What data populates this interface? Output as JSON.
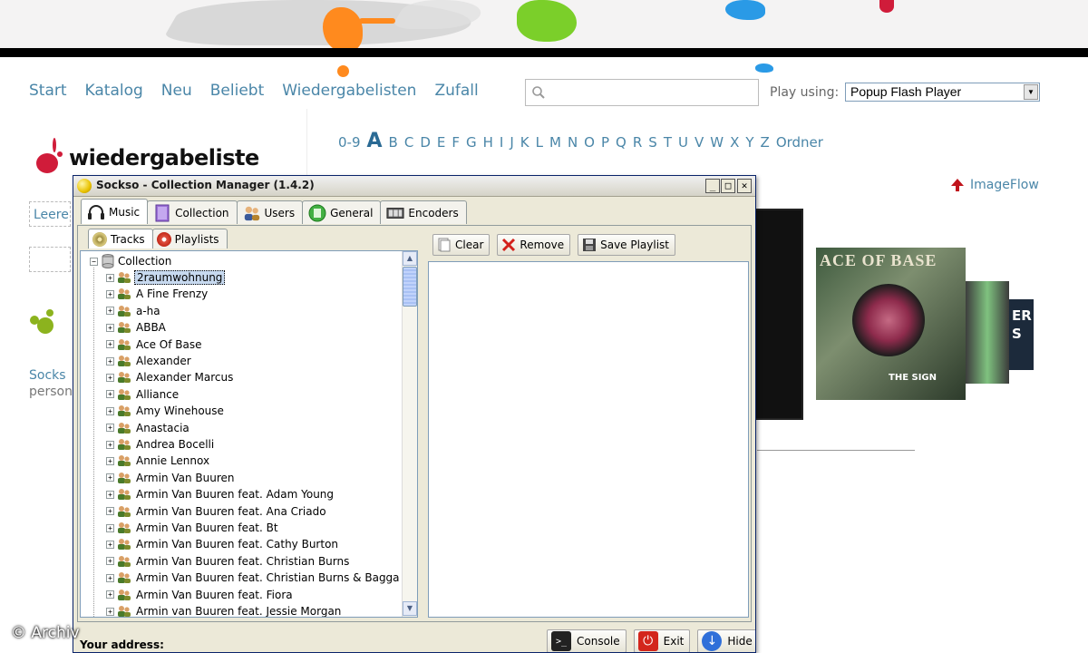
{
  "nav": {
    "items": [
      "Start",
      "Katalog",
      "Neu",
      "Beliebt",
      "Wiedergabelisten",
      "Zufall"
    ]
  },
  "search": {
    "value": "",
    "placeholder": ""
  },
  "player": {
    "label": "Play using:",
    "selected": "Popup Flash Player"
  },
  "alphabet": [
    "0-9",
    "A",
    "B",
    "C",
    "D",
    "E",
    "F",
    "G",
    "H",
    "I",
    "J",
    "K",
    "L",
    "M",
    "N",
    "O",
    "P",
    "Q",
    "R",
    "S",
    "T",
    "U",
    "V",
    "W",
    "X",
    "Y",
    "Z",
    "Ordner"
  ],
  "page": {
    "heading": "wiedergabeliste",
    "leere": "Leere",
    "sockso": "Socks",
    "person": "person"
  },
  "imageflow": {
    "label": "ImageFlow"
  },
  "covers": {
    "ace_title": "ACE OF BASE",
    "ace_sub": "THE SIGN",
    "small": "ER\nS"
  },
  "dialog": {
    "title": "Sockso - Collection Manager (1.4.2)",
    "window_buttons": [
      "_",
      "□",
      "✕"
    ],
    "tabs": [
      {
        "label": "Music",
        "icon": "headphones-icon",
        "active": true
      },
      {
        "label": "Collection",
        "icon": "collection-icon",
        "active": false
      },
      {
        "label": "Users",
        "icon": "users-icon",
        "active": false
      },
      {
        "label": "General",
        "icon": "general-icon",
        "active": false
      },
      {
        "label": "Encoders",
        "icon": "encoders-icon",
        "active": false
      }
    ],
    "subtabs": [
      {
        "label": "Tracks",
        "icon": "tracks-icon",
        "active": true
      },
      {
        "label": "Playlists",
        "icon": "playlists-icon",
        "active": false
      }
    ],
    "tree": {
      "root": "Collection",
      "selected": "2raumwohnung",
      "artists": [
        "2raumwohnung",
        "A Fine Frenzy",
        "a-ha",
        "ABBA",
        "Ace Of Base",
        "Alexander",
        "Alexander Marcus",
        "Alliance",
        "Amy Winehouse",
        "Anastacia",
        "Andrea Bocelli",
        "Annie Lennox",
        "Armin Van Buuren",
        "Armin Van Buuren feat. Adam Young",
        "Armin Van Buuren feat. Ana Criado",
        "Armin Van Buuren feat. Bt",
        "Armin Van Buuren feat. Cathy Burton",
        "Armin Van Buuren feat. Christian Burns",
        "Armin Van Buuren feat. Christian Burns & Bagga Bownz",
        "Armin Van Buuren feat. Fiora",
        "Armin van Buuren feat. Jessie Morgan"
      ]
    },
    "toolbar": {
      "clear": "Clear",
      "remove": "Remove",
      "save_playlist": "Save Playlist"
    },
    "status": {
      "address_label": "Your address:",
      "console": "Console",
      "exit": "Exit",
      "hide": "Hide"
    }
  },
  "watermark": "© Archiv",
  "colors": {
    "link": "#4a86a8",
    "orange_splat": "#ff8a1e",
    "green_splat": "#7bcf2a",
    "blue_splat": "#2a9ae6",
    "red_splat": "#d01c3a",
    "selection": "#c7d9ef"
  }
}
